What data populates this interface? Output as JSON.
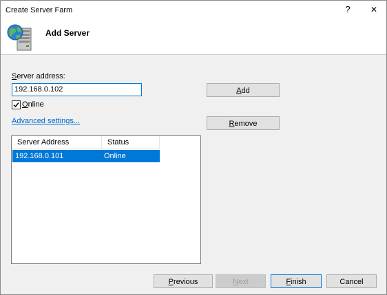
{
  "window": {
    "title": "Create Server Farm",
    "help_glyph": "?",
    "close_glyph": "✕"
  },
  "header": {
    "title": "Add Server",
    "icon": "server-globe-icon"
  },
  "form": {
    "server_address_label_accel": "S",
    "server_address_label_rest": "erver address:",
    "server_address_value": "192.168.0.102",
    "online_label_accel": "O",
    "online_label_rest": "nline",
    "online_checked": true,
    "advanced_link": "Advanced settings..."
  },
  "buttons": {
    "add_accel": "A",
    "add_rest": "dd",
    "remove_accel": "R",
    "remove_rest": "emove"
  },
  "server_list": {
    "columns": [
      "Server Address",
      "Status"
    ],
    "rows": [
      {
        "address": "192.168.0.101",
        "status": "Online",
        "selected": true
      }
    ]
  },
  "footer": {
    "previous_accel": "P",
    "previous_rest": "revious",
    "next_accel": "N",
    "next_rest": "ext",
    "finish_accel": "F",
    "finish_rest": "inish",
    "cancel": "Cancel"
  },
  "colors": {
    "selection": "#0078d7",
    "link": "#0066cc",
    "focus_border": "#0078d7"
  }
}
